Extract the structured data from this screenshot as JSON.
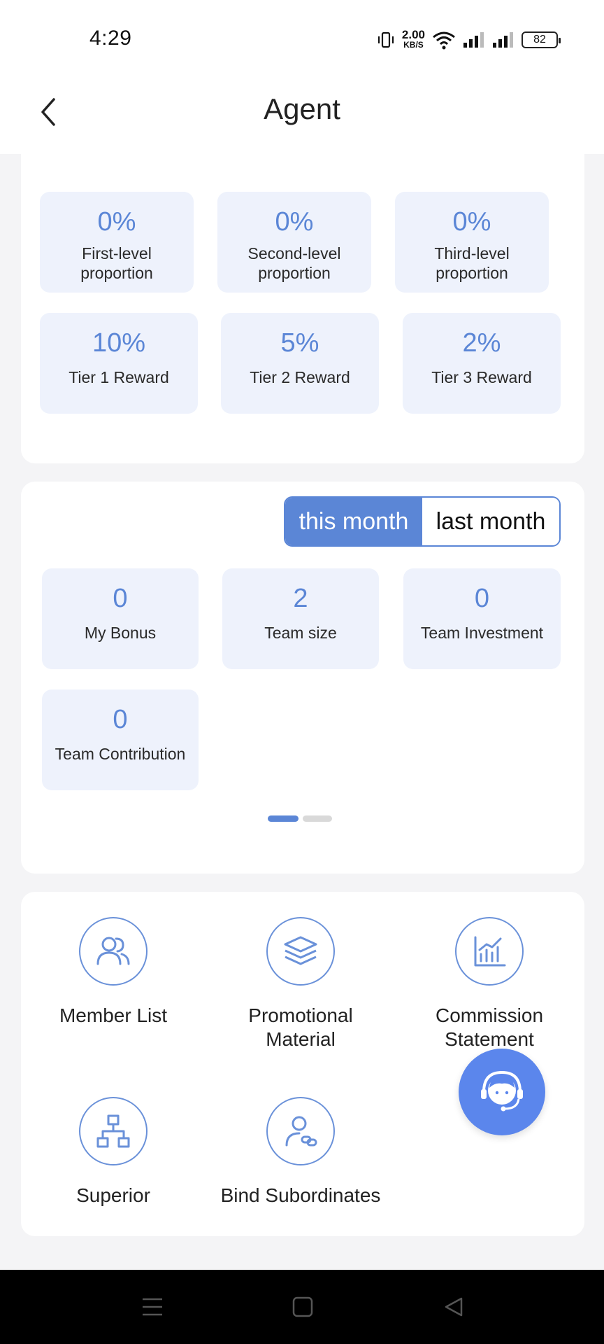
{
  "status_bar": {
    "time": "4:29",
    "speed_value": "2.00",
    "speed_unit": "KB/S",
    "battery": "82"
  },
  "header": {
    "title": "Agent"
  },
  "proportions": [
    {
      "value": "0%",
      "label_line1": "First-level",
      "label_line2": "proportion"
    },
    {
      "value": "0%",
      "label_line1": "Second-level",
      "label_line2": "proportion"
    },
    {
      "value": "0%",
      "label_line1": "Third-level",
      "label_line2": "proportion"
    }
  ],
  "rewards": [
    {
      "value": "10%",
      "label": "Tier 1 Reward"
    },
    {
      "value": "5%",
      "label": "Tier 2 Reward"
    },
    {
      "value": "2%",
      "label": "Tier 3 Reward"
    }
  ],
  "period_toggle": {
    "this_month": "this month",
    "last_month": "last month",
    "selected": "this_month"
  },
  "stats": [
    {
      "value": "0",
      "label": "My Bonus"
    },
    {
      "value": "2",
      "label": "Team size"
    },
    {
      "value": "0",
      "label": "Team Investment"
    },
    {
      "value": "0",
      "label": "Team Contribution"
    }
  ],
  "pager": {
    "current_page": 1,
    "total_pages": 2
  },
  "menu": [
    {
      "label_line1": "Member List",
      "label_line2": "",
      "icon": "users-icon"
    },
    {
      "label_line1": "Promotional",
      "label_line2": "Material",
      "icon": "layers-icon"
    },
    {
      "label_line1": "Commission",
      "label_line2": "Statement",
      "icon": "bar-chart-icon"
    },
    {
      "label_line1": "Superior",
      "label_line2": "",
      "icon": "hierarchy-icon"
    },
    {
      "label_line1": "Bind Subordinates",
      "label_line2": "",
      "icon": "user-link-icon"
    }
  ],
  "colors": {
    "accent": "#5b86d6",
    "tile_bg": "#eef2fc",
    "fab": "#5b86ec"
  }
}
